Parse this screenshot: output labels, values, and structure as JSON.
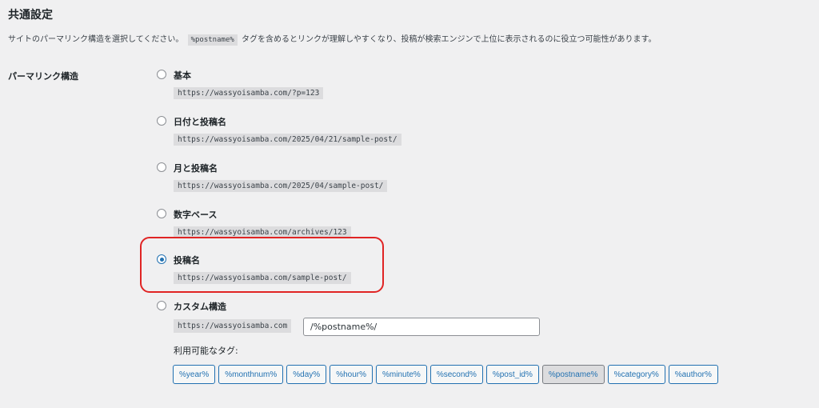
{
  "section": {
    "title": "共通設定",
    "description_before": "サイトのパーマリンク構造を選択してください。",
    "description_code": "%postname%",
    "description_after": "タグを含めるとリンクが理解しやすくなり、投稿が検索エンジンで上位に表示されるのに役立つ可能性があります。"
  },
  "permalink": {
    "row_label": "パーマリンク構造",
    "options": [
      {
        "label": "基本",
        "url": "https://wassyoisamba.com/?p=123",
        "checked": false
      },
      {
        "label": "日付と投稿名",
        "url": "https://wassyoisamba.com/2025/04/21/sample-post/",
        "checked": false
      },
      {
        "label": "月と投稿名",
        "url": "https://wassyoisamba.com/2025/04/sample-post/",
        "checked": false
      },
      {
        "label": "数字ベース",
        "url": "https://wassyoisamba.com/archives/123",
        "checked": false
      },
      {
        "label": "投稿名",
        "url": "https://wassyoisamba.com/sample-post/",
        "checked": true
      },
      {
        "label": "カスタム構造",
        "checked": false
      }
    ],
    "custom": {
      "base_url": "https://wassyoisamba.com",
      "value": "/%postname%/"
    },
    "available_tags_label": "利用可能なタグ:",
    "tags": [
      {
        "label": "%year%",
        "active": false
      },
      {
        "label": "%monthnum%",
        "active": false
      },
      {
        "label": "%day%",
        "active": false
      },
      {
        "label": "%hour%",
        "active": false
      },
      {
        "label": "%minute%",
        "active": false
      },
      {
        "label": "%second%",
        "active": false
      },
      {
        "label": "%post_id%",
        "active": false
      },
      {
        "label": "%postname%",
        "active": true
      },
      {
        "label": "%category%",
        "active": false
      },
      {
        "label": "%author%",
        "active": false
      }
    ]
  },
  "colors": {
    "background": "#f0f0f1",
    "accent": "#2271b1",
    "highlight_border": "#e02424"
  }
}
